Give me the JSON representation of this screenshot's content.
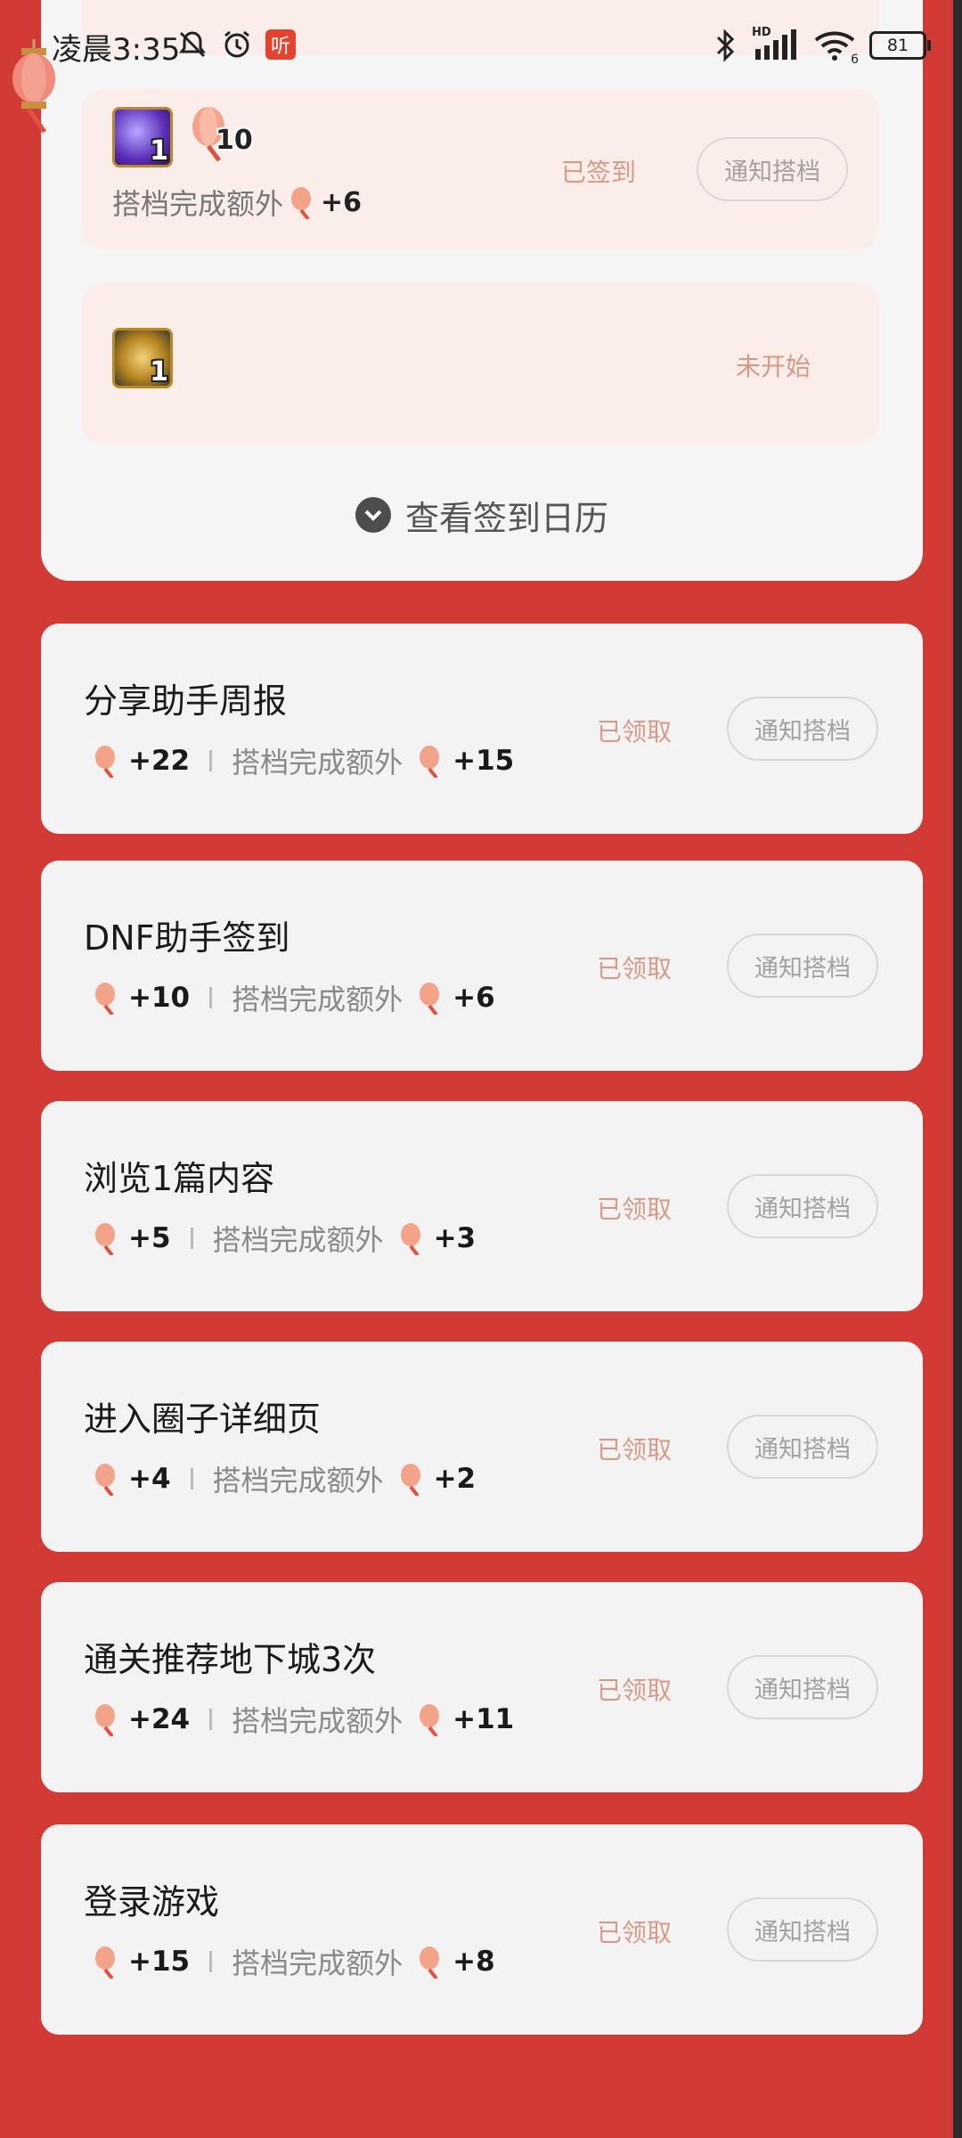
{
  "status_bar": {
    "time": "凌晨3:35",
    "listen_badge": "听",
    "battery": "81",
    "signal": "HD",
    "wifi_sub": "6"
  },
  "top_card": {
    "rows": [
      {
        "items": [
          {
            "icon": "purple-orb-icon",
            "qty": "1"
          },
          {
            "icon": "lantern-bulb-icon",
            "qty": "10"
          }
        ],
        "bonus_label": "搭档完成额外",
        "bonus_value": "+6",
        "status": "已签到",
        "button": "通知搭档"
      },
      {
        "items": [
          {
            "icon": "golden-clock-icon",
            "qty": "1"
          }
        ],
        "status": "未开始"
      }
    ],
    "calendar_link": "查看签到日历"
  },
  "tasks": [
    {
      "title": "分享助手周报",
      "reward": "+22",
      "extra_label": "搭档完成额外",
      "extra_reward": "+15",
      "status": "已领取",
      "button": "通知搭档"
    },
    {
      "title": "DNF助手签到",
      "reward": "+10",
      "extra_label": "搭档完成额外",
      "extra_reward": "+6",
      "status": "已领取",
      "button": "通知搭档"
    },
    {
      "title": "浏览1篇内容",
      "reward": "+5",
      "extra_label": "搭档完成额外",
      "extra_reward": "+3",
      "status": "已领取",
      "button": "通知搭档"
    },
    {
      "title": "进入圈子详细页",
      "reward": "+4",
      "extra_label": "搭档完成额外",
      "extra_reward": "+2",
      "status": "已领取",
      "button": "通知搭档"
    },
    {
      "title": "通关推荐地下城3次",
      "reward": "+24",
      "extra_label": "搭档完成额外",
      "extra_reward": "+11",
      "status": "已领取",
      "button": "通知搭档"
    },
    {
      "title": "登录游戏",
      "reward": "+15",
      "extra_label": "搭档完成额外",
      "extra_reward": "+8",
      "status": "已领取",
      "button": "通知搭档"
    }
  ],
  "colors": {
    "page_background": "#d23a36",
    "card_background": "#f4f3f3",
    "row_background": "#fbeeea",
    "status_text": "#d79a86"
  }
}
